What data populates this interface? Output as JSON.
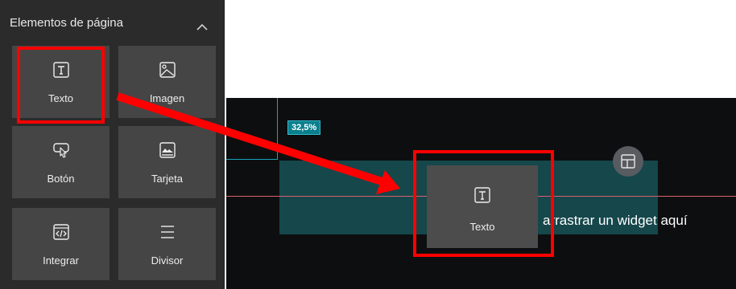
{
  "panel": {
    "title": "Elementos de página",
    "collapse_icon": "chevron-up-icon",
    "items": [
      {
        "label": "Texto",
        "icon": "text-icon"
      },
      {
        "label": "Imagen",
        "icon": "image-icon"
      },
      {
        "label": "Botón",
        "icon": "button-icon"
      },
      {
        "label": "Tarjeta",
        "icon": "card-icon"
      },
      {
        "label": "Integrar",
        "icon": "embed-icon"
      },
      {
        "label": "Divisor",
        "icon": "divider-icon"
      }
    ]
  },
  "canvas": {
    "size_badge": "32,5%",
    "layout_icon": "layout-icon",
    "dragging_widget": {
      "label": "Texto",
      "icon": "text-icon"
    },
    "drop_hint": "arrastrar un widget aquí"
  },
  "colors": {
    "highlight": "#ff0000",
    "arrow": "#ff0000",
    "badge": "#0a7f8d",
    "drop_zone": "#15474b",
    "guide_line": "#d8606c"
  }
}
